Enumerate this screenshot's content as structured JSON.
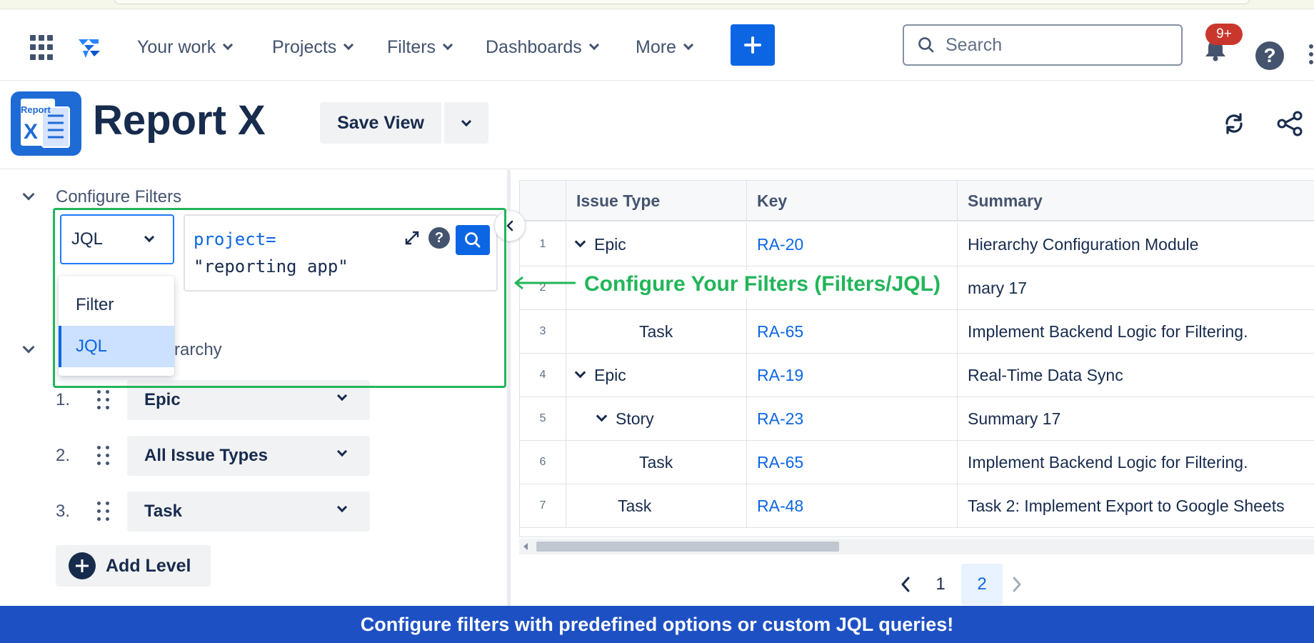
{
  "nav": {
    "items": [
      {
        "label": "Your work"
      },
      {
        "label": "Projects"
      },
      {
        "label": "Filters"
      },
      {
        "label": "Dashboards"
      },
      {
        "label": "More"
      }
    ],
    "search_placeholder": "Search",
    "notification_count": "9+",
    "help_glyph": "?"
  },
  "report": {
    "logo_text_top": "Report",
    "logo_text_x": "X",
    "title": "Report X",
    "save_view_label": "Save View"
  },
  "filters": {
    "section_label": "Configure Filters",
    "mode_value": "JQL",
    "jql_line1": "project=",
    "jql_line2": "\"reporting app\"",
    "help_glyph": "?",
    "dropdown_options": [
      {
        "label": "Filter",
        "selected": false
      },
      {
        "label": "JQL",
        "selected": true
      }
    ]
  },
  "hierarchy": {
    "section_label_visible": "rarchy",
    "levels": [
      {
        "num": "1.",
        "value": "Epic"
      },
      {
        "num": "2.",
        "value": "All Issue Types"
      },
      {
        "num": "3.",
        "value": "Task"
      }
    ],
    "add_level_label": "Add Level"
  },
  "table": {
    "columns": [
      "Issue Type",
      "Key",
      "Summary"
    ],
    "rows": [
      {
        "num": "1",
        "type": "Epic",
        "caret": true,
        "indent": 0,
        "key": "RA-20",
        "summary": "Hierarchy Configuration Module"
      },
      {
        "num": "2",
        "type": "",
        "caret": false,
        "indent": 0,
        "key": "",
        "summary": "mary 17"
      },
      {
        "num": "3",
        "type": "Task",
        "caret": false,
        "indent": 2,
        "key": "RA-65",
        "summary": "Implement Backend Logic for Filtering."
      },
      {
        "num": "4",
        "type": "Epic",
        "caret": true,
        "indent": 0,
        "key": "RA-19",
        "summary": "Real-Time Data Sync"
      },
      {
        "num": "5",
        "type": "Story",
        "caret": true,
        "indent": 1,
        "key": "RA-23",
        "summary": "Summary 17"
      },
      {
        "num": "6",
        "type": "Task",
        "caret": false,
        "indent": 2,
        "key": "RA-65",
        "summary": "Implement Backend Logic for Filtering."
      },
      {
        "num": "7",
        "type": "Task",
        "caret": false,
        "indent": 1,
        "key": "RA-48",
        "summary": "Task 2: Implement Export to Google Sheets"
      }
    ]
  },
  "pagination": {
    "pages": [
      "1",
      "2"
    ],
    "current": "2"
  },
  "annotation": {
    "label": "Configure Your Filters (Filters/JQL)",
    "color": "#22b55a"
  },
  "footer": {
    "banner_text": "Configure filters with predefined options or custom JQL queries!"
  },
  "colors": {
    "accent": "#0c66e4",
    "banner": "#1d50c3",
    "highlight": "#22b55a"
  }
}
